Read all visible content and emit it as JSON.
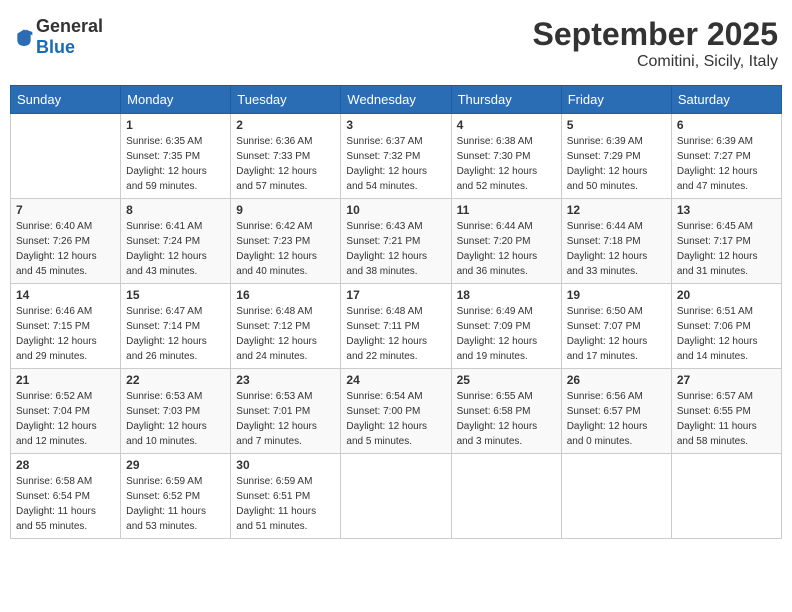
{
  "logo": {
    "general": "General",
    "blue": "Blue"
  },
  "header": {
    "month": "September 2025",
    "location": "Comitini, Sicily, Italy"
  },
  "weekdays": [
    "Sunday",
    "Monday",
    "Tuesday",
    "Wednesday",
    "Thursday",
    "Friday",
    "Saturday"
  ],
  "weeks": [
    [
      {
        "day": "",
        "info": ""
      },
      {
        "day": "1",
        "info": "Sunrise: 6:35 AM\nSunset: 7:35 PM\nDaylight: 12 hours\nand 59 minutes."
      },
      {
        "day": "2",
        "info": "Sunrise: 6:36 AM\nSunset: 7:33 PM\nDaylight: 12 hours\nand 57 minutes."
      },
      {
        "day": "3",
        "info": "Sunrise: 6:37 AM\nSunset: 7:32 PM\nDaylight: 12 hours\nand 54 minutes."
      },
      {
        "day": "4",
        "info": "Sunrise: 6:38 AM\nSunset: 7:30 PM\nDaylight: 12 hours\nand 52 minutes."
      },
      {
        "day": "5",
        "info": "Sunrise: 6:39 AM\nSunset: 7:29 PM\nDaylight: 12 hours\nand 50 minutes."
      },
      {
        "day": "6",
        "info": "Sunrise: 6:39 AM\nSunset: 7:27 PM\nDaylight: 12 hours\nand 47 minutes."
      }
    ],
    [
      {
        "day": "7",
        "info": "Sunrise: 6:40 AM\nSunset: 7:26 PM\nDaylight: 12 hours\nand 45 minutes."
      },
      {
        "day": "8",
        "info": "Sunrise: 6:41 AM\nSunset: 7:24 PM\nDaylight: 12 hours\nand 43 minutes."
      },
      {
        "day": "9",
        "info": "Sunrise: 6:42 AM\nSunset: 7:23 PM\nDaylight: 12 hours\nand 40 minutes."
      },
      {
        "day": "10",
        "info": "Sunrise: 6:43 AM\nSunset: 7:21 PM\nDaylight: 12 hours\nand 38 minutes."
      },
      {
        "day": "11",
        "info": "Sunrise: 6:44 AM\nSunset: 7:20 PM\nDaylight: 12 hours\nand 36 minutes."
      },
      {
        "day": "12",
        "info": "Sunrise: 6:44 AM\nSunset: 7:18 PM\nDaylight: 12 hours\nand 33 minutes."
      },
      {
        "day": "13",
        "info": "Sunrise: 6:45 AM\nSunset: 7:17 PM\nDaylight: 12 hours\nand 31 minutes."
      }
    ],
    [
      {
        "day": "14",
        "info": "Sunrise: 6:46 AM\nSunset: 7:15 PM\nDaylight: 12 hours\nand 29 minutes."
      },
      {
        "day": "15",
        "info": "Sunrise: 6:47 AM\nSunset: 7:14 PM\nDaylight: 12 hours\nand 26 minutes."
      },
      {
        "day": "16",
        "info": "Sunrise: 6:48 AM\nSunset: 7:12 PM\nDaylight: 12 hours\nand 24 minutes."
      },
      {
        "day": "17",
        "info": "Sunrise: 6:48 AM\nSunset: 7:11 PM\nDaylight: 12 hours\nand 22 minutes."
      },
      {
        "day": "18",
        "info": "Sunrise: 6:49 AM\nSunset: 7:09 PM\nDaylight: 12 hours\nand 19 minutes."
      },
      {
        "day": "19",
        "info": "Sunrise: 6:50 AM\nSunset: 7:07 PM\nDaylight: 12 hours\nand 17 minutes."
      },
      {
        "day": "20",
        "info": "Sunrise: 6:51 AM\nSunset: 7:06 PM\nDaylight: 12 hours\nand 14 minutes."
      }
    ],
    [
      {
        "day": "21",
        "info": "Sunrise: 6:52 AM\nSunset: 7:04 PM\nDaylight: 12 hours\nand 12 minutes."
      },
      {
        "day": "22",
        "info": "Sunrise: 6:53 AM\nSunset: 7:03 PM\nDaylight: 12 hours\nand 10 minutes."
      },
      {
        "day": "23",
        "info": "Sunrise: 6:53 AM\nSunset: 7:01 PM\nDaylight: 12 hours\nand 7 minutes."
      },
      {
        "day": "24",
        "info": "Sunrise: 6:54 AM\nSunset: 7:00 PM\nDaylight: 12 hours\nand 5 minutes."
      },
      {
        "day": "25",
        "info": "Sunrise: 6:55 AM\nSunset: 6:58 PM\nDaylight: 12 hours\nand 3 minutes."
      },
      {
        "day": "26",
        "info": "Sunrise: 6:56 AM\nSunset: 6:57 PM\nDaylight: 12 hours\nand 0 minutes."
      },
      {
        "day": "27",
        "info": "Sunrise: 6:57 AM\nSunset: 6:55 PM\nDaylight: 11 hours\nand 58 minutes."
      }
    ],
    [
      {
        "day": "28",
        "info": "Sunrise: 6:58 AM\nSunset: 6:54 PM\nDaylight: 11 hours\nand 55 minutes."
      },
      {
        "day": "29",
        "info": "Sunrise: 6:59 AM\nSunset: 6:52 PM\nDaylight: 11 hours\nand 53 minutes."
      },
      {
        "day": "30",
        "info": "Sunrise: 6:59 AM\nSunset: 6:51 PM\nDaylight: 11 hours\nand 51 minutes."
      },
      {
        "day": "",
        "info": ""
      },
      {
        "day": "",
        "info": ""
      },
      {
        "day": "",
        "info": ""
      },
      {
        "day": "",
        "info": ""
      }
    ]
  ]
}
